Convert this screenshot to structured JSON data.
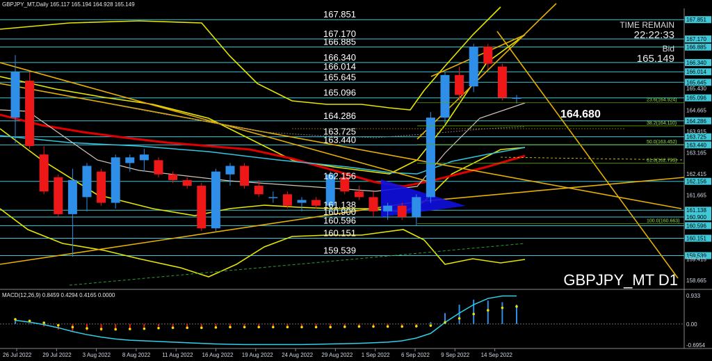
{
  "window": {
    "title": "GBPJPY_MT,Daily  165.117 165.194 164.928 165.149",
    "symbol_watermark": "GBPJPY_MT D1"
  },
  "panel": {
    "time_remain_label": "TIME REMAIN",
    "time_remain_value": "22:22:33",
    "bid_label": "Bid",
    "bid_value": "165.149",
    "current_price_label": "164.680"
  },
  "levels": [
    {
      "value": "167.851",
      "price": 167.851
    },
    {
      "value": "167.170",
      "price": 167.17
    },
    {
      "value": "166.885",
      "price": 166.885
    },
    {
      "value": "166.340",
      "price": 166.34
    },
    {
      "value": "166.014",
      "price": 166.014
    },
    {
      "value": "165.645",
      "price": 165.645
    },
    {
      "value": "165.096",
      "price": 165.096
    },
    {
      "value": "164.286",
      "price": 164.286
    },
    {
      "value": "163.725",
      "price": 163.725
    },
    {
      "value": "163.440",
      "price": 163.44
    },
    {
      "value": "162.156",
      "price": 162.156
    },
    {
      "value": "161.138",
      "price": 161.138
    },
    {
      "value": "160.900",
      "price": 160.9
    },
    {
      "value": "160.596",
      "price": 160.596
    },
    {
      "value": "160.151",
      "price": 160.151
    },
    {
      "value": "159.539",
      "price": 159.539
    }
  ],
  "fib_labels": [
    {
      "text": "23.6(164.924)",
      "price": 164.924
    },
    {
      "text": "38.2(164.110)",
      "price": 164.11
    },
    {
      "text": "50.0(163.452)",
      "price": 163.452
    },
    {
      "text": "61.8(162.793)",
      "price": 162.793
    },
    {
      "text": "100.0(160.663)",
      "price": 160.663
    }
  ],
  "price_axis": {
    "labels": [
      "167.851",
      "167.170",
      "166.885",
      "166.340",
      "166.014",
      "165.645",
      "165.430",
      "165.096",
      "164.665",
      "164.286",
      "163.915",
      "163.725",
      "163.440",
      "163.165",
      "162.415",
      "162.156",
      "161.665",
      "161.138",
      "160.900",
      "160.596",
      "160.151",
      "159.539",
      "159.415",
      "158.665"
    ],
    "highlighted": [
      "167.851",
      "167.170",
      "166.885",
      "166.340",
      "166.014",
      "165.645",
      "165.096",
      "164.286",
      "163.725",
      "163.440",
      "162.156",
      "161.138",
      "160.900",
      "160.596",
      "160.151",
      "159.539"
    ]
  },
  "time_axis": {
    "labels": [
      "26 Jul 2022",
      "29 Jul 2022",
      "3 Aug 2022",
      "8 Aug 2022",
      "11 Aug 2022",
      "16 Aug 2022",
      "19 Aug 2022",
      "24 Aug 2022",
      "29 Aug 2022",
      "1 Sep 2022",
      "6 Sep 2022",
      "9 Sep 2022",
      "14 Sep 2022"
    ]
  },
  "macd": {
    "label": "MACD(12,26,9) 0.8459 0.4294 0.4165 0.0000",
    "axis_labels": [
      "0.933",
      "0.00",
      "-0.6954"
    ]
  },
  "chart_data": {
    "type": "candlestick",
    "title": "GBPJPY_MT,Daily",
    "price_range": [
      158.4,
      168.2
    ],
    "candles": [
      {
        "o": 164.4,
        "h": 166.6,
        "l": 163.5,
        "c": 166.0
      },
      {
        "o": 165.7,
        "h": 166.0,
        "l": 163.3,
        "c": 163.4
      },
      {
        "o": 163.1,
        "h": 163.4,
        "l": 161.7,
        "c": 161.8
      },
      {
        "o": 162.3,
        "h": 162.4,
        "l": 160.9,
        "c": 161.0
      },
      {
        "o": 161.0,
        "h": 162.6,
        "l": 159.5,
        "c": 162.2
      },
      {
        "o": 161.6,
        "h": 162.8,
        "l": 161.1,
        "c": 162.7
      },
      {
        "o": 162.5,
        "h": 162.6,
        "l": 161.3,
        "c": 161.4
      },
      {
        "o": 161.4,
        "h": 163.1,
        "l": 161.2,
        "c": 163.0
      },
      {
        "o": 162.8,
        "h": 163.1,
        "l": 162.5,
        "c": 163.0
      },
      {
        "o": 162.9,
        "h": 163.3,
        "l": 162.5,
        "c": 163.1
      },
      {
        "o": 162.9,
        "h": 163.0,
        "l": 162.3,
        "c": 162.4
      },
      {
        "o": 162.4,
        "h": 162.5,
        "l": 162.1,
        "c": 162.2
      },
      {
        "o": 162.2,
        "h": 162.3,
        "l": 161.9,
        "c": 162.0
      },
      {
        "o": 162.0,
        "h": 162.1,
        "l": 160.4,
        "c": 160.5
      },
      {
        "o": 160.5,
        "h": 162.6,
        "l": 160.4,
        "c": 162.5
      },
      {
        "o": 162.4,
        "h": 162.8,
        "l": 162.0,
        "c": 162.7
      },
      {
        "o": 162.7,
        "h": 162.8,
        "l": 161.9,
        "c": 162.0
      },
      {
        "o": 162.0,
        "h": 162.2,
        "l": 161.6,
        "c": 161.7
      },
      {
        "o": 161.6,
        "h": 161.8,
        "l": 161.4,
        "c": 161.6
      },
      {
        "o": 161.7,
        "h": 161.8,
        "l": 161.2,
        "c": 161.3
      },
      {
        "o": 161.4,
        "h": 161.6,
        "l": 161.1,
        "c": 161.5
      },
      {
        "o": 161.5,
        "h": 161.6,
        "l": 161.2,
        "c": 161.3
      },
      {
        "o": 161.3,
        "h": 162.5,
        "l": 161.2,
        "c": 162.4
      },
      {
        "o": 162.3,
        "h": 162.4,
        "l": 161.7,
        "c": 161.8
      },
      {
        "o": 161.8,
        "h": 162.0,
        "l": 161.5,
        "c": 161.6
      },
      {
        "o": 161.6,
        "h": 161.8,
        "l": 160.9,
        "c": 161.1
      },
      {
        "o": 161.1,
        "h": 161.4,
        "l": 160.8,
        "c": 161.3
      },
      {
        "o": 161.3,
        "h": 161.4,
        "l": 160.8,
        "c": 160.9
      },
      {
        "o": 160.9,
        "h": 161.7,
        "l": 160.6,
        "c": 161.6
      },
      {
        "o": 161.6,
        "h": 164.6,
        "l": 161.4,
        "c": 164.4
      },
      {
        "o": 164.4,
        "h": 166.0,
        "l": 164.2,
        "c": 165.9
      },
      {
        "o": 165.9,
        "h": 166.2,
        "l": 165.0,
        "c": 165.2
      },
      {
        "o": 165.5,
        "h": 167.0,
        "l": 165.3,
        "c": 166.9
      },
      {
        "o": 166.9,
        "h": 167.0,
        "l": 166.1,
        "c": 166.3
      },
      {
        "o": 166.2,
        "h": 166.3,
        "l": 165.0,
        "c": 165.1
      },
      {
        "o": 165.1,
        "h": 165.2,
        "l": 164.9,
        "c": 165.1
      }
    ],
    "macd_histogram": [
      0.1,
      0.02,
      -0.08,
      -0.18,
      -0.22,
      -0.2,
      -0.22,
      -0.18,
      -0.15,
      -0.1,
      -0.08,
      -0.1,
      -0.09,
      -0.12,
      -0.1,
      -0.08,
      -0.08,
      -0.09,
      -0.1,
      -0.11,
      -0.1,
      -0.1,
      -0.08,
      -0.07,
      -0.07,
      -0.08,
      -0.08,
      -0.07,
      -0.05,
      0.06,
      0.35,
      0.62,
      0.78,
      0.75,
      0.7,
      0.62
    ],
    "macd_signal": [
      0.15,
      0.1,
      0.04,
      -0.04,
      -0.1,
      -0.14,
      -0.16,
      -0.17,
      -0.16,
      -0.15,
      -0.13,
      -0.12,
      -0.12,
      -0.12,
      -0.11,
      -0.1,
      -0.1,
      -0.1,
      -0.1,
      -0.1,
      -0.1,
      -0.1,
      -0.1,
      -0.09,
      -0.08,
      -0.08,
      -0.08,
      -0.08,
      -0.07,
      -0.05,
      0.05,
      0.18,
      0.32,
      0.44,
      0.52,
      0.56
    ],
    "macd_main": [
      0.12,
      0.06,
      -0.02,
      -0.12,
      -0.24,
      -0.34,
      -0.42,
      -0.48,
      -0.52,
      -0.54,
      -0.56,
      -0.58,
      -0.6,
      -0.62,
      -0.64,
      -0.65,
      -0.66,
      -0.66,
      -0.66,
      -0.66,
      -0.66,
      -0.65,
      -0.64,
      -0.63,
      -0.62,
      -0.6,
      -0.58,
      -0.54,
      -0.45,
      -0.3,
      0.05,
      0.35,
      0.62,
      0.82,
      0.9,
      0.9
    ],
    "macd_range": [
      -0.6954,
      0.933
    ]
  }
}
